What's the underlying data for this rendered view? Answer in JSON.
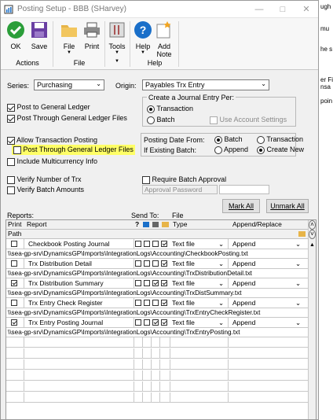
{
  "window": {
    "title": "Posting Setup  -  BBB (SHarvey)"
  },
  "ribbon": {
    "buttons": {
      "ok": "OK",
      "save": "Save",
      "file": "File",
      "print": "Print",
      "tools": "Tools",
      "help": "Help",
      "add_note": "Add Note"
    },
    "groups": {
      "actions": "Actions",
      "file": "File",
      "help": "Help"
    }
  },
  "form": {
    "series_label": "Series:",
    "series_value": "Purchasing",
    "origin_label": "Origin:",
    "origin_value": "Payables Trx Entry",
    "post_to_gl": "Post to General Ledger",
    "post_through_gl": "Post Through General Ledger Files",
    "create_journal_label": "Create a Journal Entry Per:",
    "transaction": "Transaction",
    "batch": "Batch",
    "use_account_settings": "Use Account Settings",
    "allow_transaction_posting": "Allow Transaction Posting",
    "post_through_gl_files_2": "Post Through General Ledger Files",
    "include_multicurrency": "Include Multicurrency Info",
    "posting_date_from": "Posting Date From:",
    "if_existing_batch": "If Existing Batch:",
    "append": "Append",
    "create_new": "Create New",
    "verify_number_of_trx": "Verify Number of Trx",
    "verify_batch_amounts": "Verify Batch Amounts",
    "require_batch_approval": "Require Batch Approval",
    "approval_password": "Approval Password",
    "mark_all": "Mark All",
    "unmark_all": "Unmark All"
  },
  "reports": {
    "label": "Reports:",
    "send_to": "Send To:",
    "file_label": "File",
    "columns": {
      "print": "Print",
      "report": "Report",
      "type": "Type",
      "append_replace": "Append/Replace",
      "path": "Path",
      "question": "?"
    },
    "rows": [
      {
        "name": "Checkbook Posting Journal",
        "printed": false,
        "type": "Text file",
        "mode": "Append",
        "path": "\\\\sea-gp-srv\\DynamicsGP\\Imports\\IntegrationLogs\\Accounting\\CheckbookPosting.txt"
      },
      {
        "name": "Trx Distribution Detail",
        "printed": false,
        "type": "Text file",
        "mode": "Append",
        "path": "\\\\sea-gp-srv\\DynamicsGP\\Imports\\IntegrationLogs\\Accounting\\TrxDistributionDetail.txt"
      },
      {
        "name": "Trx Distribution Summary",
        "printed": true,
        "type": "Text file",
        "mode": "Append",
        "path": "\\\\sea-gp-srv\\DynamicsGP\\Imports\\IntegrationLogs\\Accounting\\TrxDistSummary.txt"
      },
      {
        "name": "Trx Entry Check Register",
        "printed": false,
        "type": "Text file",
        "mode": "Append",
        "path": "\\\\sea-gp-srv\\DynamicsGP\\Imports\\IntegrationLogs\\Accounting\\TrxEntryCheckRegister.txt"
      },
      {
        "name": "Trx Entry Posting Journal",
        "printed": true,
        "type": "Text file",
        "mode": "Append",
        "path": "\\\\sea-gp-srv\\DynamicsGP\\Imports\\IntegrationLogs\\Accounting\\TrxEntryPosting.txt"
      }
    ]
  },
  "behind_window": {
    "lines": [
      "ugh",
      "mu",
      "he s",
      "er Fi",
      "nsa",
      "poin"
    ]
  },
  "colors": {
    "highlight": "#ffff66",
    "accent": "#1a6fc9",
    "ok_green": "#2b9e3a"
  }
}
